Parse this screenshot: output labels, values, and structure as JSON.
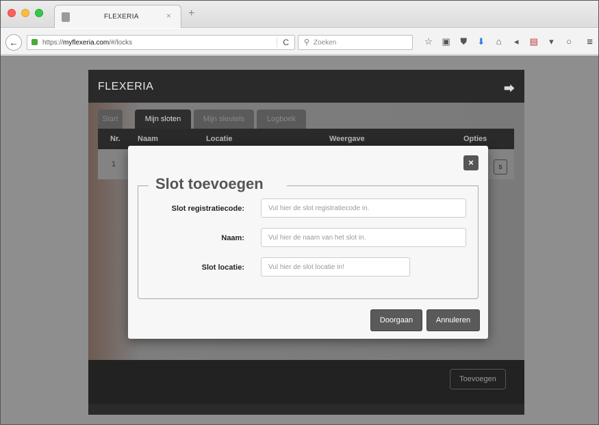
{
  "browser": {
    "tab_title": "FLEXERIA",
    "tab_close": "×",
    "new_tab": "+",
    "url_prefix": "https://",
    "url_domain": "myflexeria.com",
    "url_path": "/#/locks",
    "reload": "C",
    "search_placeholder": "Zoeken",
    "toolbar_icons": [
      "☆",
      "▣",
      "⛊",
      "⬇",
      "⌂",
      "◂",
      "▤",
      "▾",
      "○"
    ],
    "menu": "≡"
  },
  "app": {
    "title": "FLEXERIA",
    "logout_icon": "⮕",
    "tabs": [
      {
        "label": "Start",
        "active": false
      },
      {
        "label": "Mijn sloten",
        "active": true
      },
      {
        "label": "Mijn sleutels",
        "active": false
      },
      {
        "label": "Logboek",
        "active": false
      }
    ],
    "table": {
      "columns": [
        "Nr.",
        "Naam",
        "Locatie",
        "Weergave",
        "Opties"
      ],
      "rows": [
        {
          "nr": "1",
          "option": "s"
        }
      ]
    },
    "add_button": "Toevoegen"
  },
  "modal": {
    "close": "×",
    "legend": "Slot toevoegen",
    "fields": [
      {
        "label": "Slot registratiecode:",
        "placeholder": "Vul hier de slot registratiecode in.",
        "value": ""
      },
      {
        "label": "Naam:",
        "placeholder": "Vul hier de naam van het slot in.",
        "value": ""
      },
      {
        "label": "Slot locatie:",
        "placeholder": "Vul hier de slot locatie in!",
        "value": ""
      }
    ],
    "submit": "Doorgaan",
    "cancel": "Annuleren"
  }
}
